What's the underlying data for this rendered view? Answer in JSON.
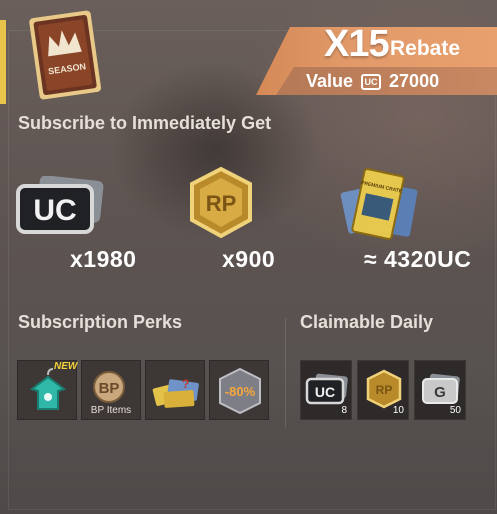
{
  "season_badge": {
    "label": "SEASON",
    "icon": "crown-icon"
  },
  "banner": {
    "multiplier": "X15",
    "rebate_label": "Rebate",
    "value_label": "Value",
    "value_currency_icon": "uc-icon",
    "value_currency_text": "UC",
    "value_amount": "27000"
  },
  "subscribe_heading": "Subscribe to Immediately Get",
  "rewards": [
    {
      "icon": "uc-icon",
      "icon_text": "UC",
      "amount": "x1980"
    },
    {
      "icon": "rp-icon",
      "icon_text": "RP",
      "amount": "x900"
    },
    {
      "icon": "premium-crate-icon",
      "icon_text": "PREMIUM CRATE",
      "amount": "≈ 4320UC"
    }
  ],
  "perks_heading": "Subscription Perks",
  "perks": [
    {
      "icon": "outfit-hanger-icon",
      "badge": "NEW",
      "label": ""
    },
    {
      "icon": "bp-icon",
      "icon_text": "BP",
      "label": "BP Items"
    },
    {
      "icon": "coupons-icon",
      "label": ""
    },
    {
      "icon": "discount-icon",
      "icon_text": "-80%",
      "label": ""
    }
  ],
  "daily_heading": "Claimable Daily",
  "daily": [
    {
      "icon": "uc-icon",
      "icon_text": "UC",
      "count": "8"
    },
    {
      "icon": "rp-icon",
      "icon_text": "RP",
      "count": "10"
    },
    {
      "icon": "g-coin-icon",
      "icon_text": "G",
      "count": "50"
    }
  ],
  "colors": {
    "accent_gold": "#d9b24a",
    "banner_orange": "#e29a6a",
    "panel": "#5e5451"
  }
}
